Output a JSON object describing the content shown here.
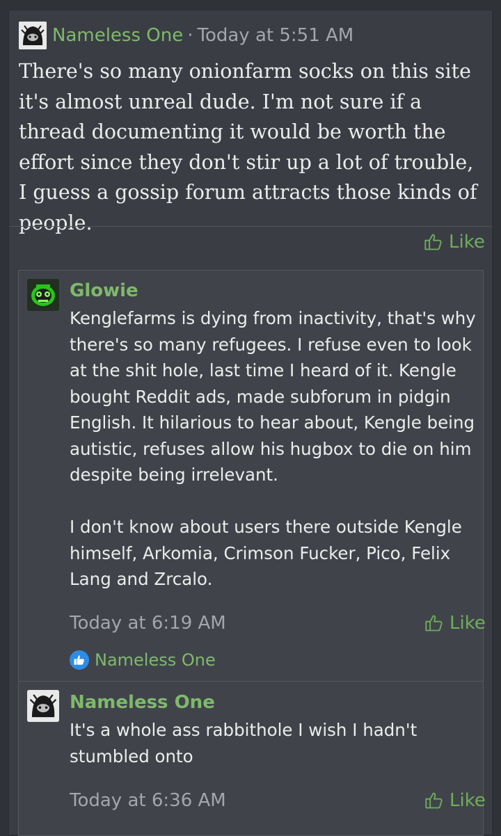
{
  "post": {
    "author": "Nameless One",
    "separator": "·",
    "time": "Today at 5:51 AM",
    "body": "There's so many onionfarm socks on this site it's almost unreal dude. I'm not sure if a thread documenting it would be worth the effort since they don't stir up a lot of trouble, I guess a gossip forum attracts those kinds of people.",
    "like_label": "Like"
  },
  "replies": [
    {
      "author": "Glowie",
      "body": "Kenglefarms is dying from inactivity, that's why there's so many refugees. I refuse even to look at the shit hole, last time I heard of it. Kengle bought Reddit ads, made subforum in pidgin English. It hilarious to hear about, Kengle being autistic, refuses allow his hugbox to die on him despite being irrelevant.\n\nI don't know about users there outside Kengle himself, Arkomia, Crimson Fucker, Pico, Felix Lang and Zrcalo.",
      "time": "Today at 6:19 AM",
      "like_label": "Like",
      "reaction_user": "Nameless One"
    },
    {
      "author": "Nameless One",
      "body": "It's a whole ass rabbithole I wish I hadn't stumbled onto",
      "time": "Today at 6:36 AM",
      "like_label": "Like"
    }
  ],
  "icons": {
    "like": "thumbs-up-icon",
    "reaction": "like-reaction-icon",
    "avatar_nameless": "avatar-nameless-one",
    "avatar_glowie": "avatar-glowie"
  },
  "colors": {
    "background": "#2f3237",
    "username": "#7fb96c",
    "like": "#6fae5b",
    "text": "#ececec",
    "meta": "#a3a7ad",
    "reaction_badge": "#2d8ce6"
  }
}
